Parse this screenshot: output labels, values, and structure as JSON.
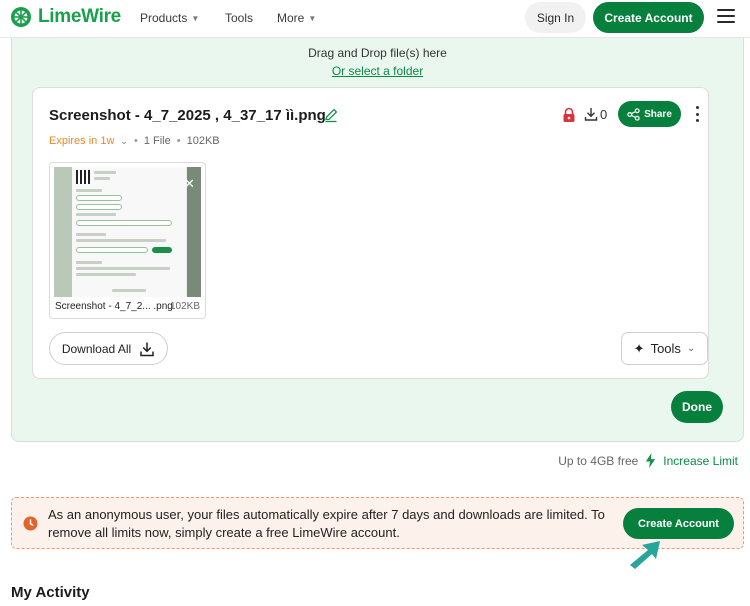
{
  "header": {
    "brand": "LimeWire",
    "nav": [
      {
        "label": "Products",
        "has_dropdown": true
      },
      {
        "label": "Tools",
        "has_dropdown": false
      },
      {
        "label": "More",
        "has_dropdown": true
      }
    ],
    "sign_in": "Sign In",
    "create_account": "Create Account"
  },
  "upload": {
    "drag_drop": "Drag and Drop file(s) here",
    "select_folder": "Or select a folder"
  },
  "file_card": {
    "filename": "Screenshot - 4_7_2025 , 4_37_17 ìì.png",
    "download_count": "0",
    "share_label": "Share",
    "expires": "Expires in 1w",
    "file_count": "1 File",
    "size": "102KB",
    "thumbnail": {
      "name": "Screenshot - 4_7_2... .png",
      "size": "102KB"
    },
    "download_all": "Download All",
    "tools": "Tools"
  },
  "done_label": "Done",
  "limit": {
    "text": "Up to 4GB free",
    "link": "Increase Limit"
  },
  "banner": {
    "message": "As an anonymous user, your files automatically expire after 7 days and downloads are limited. To remove all limits now, simply create a free LimeWire account.",
    "button": "Create Account"
  },
  "activity_heading": "My Activity",
  "colors": {
    "brand_green": "#07803d",
    "panel_bg": "#eaf7ee",
    "expires_orange": "#e8892b",
    "banner_bg": "#fdf1eb",
    "pointer_teal": "#27a59a"
  }
}
